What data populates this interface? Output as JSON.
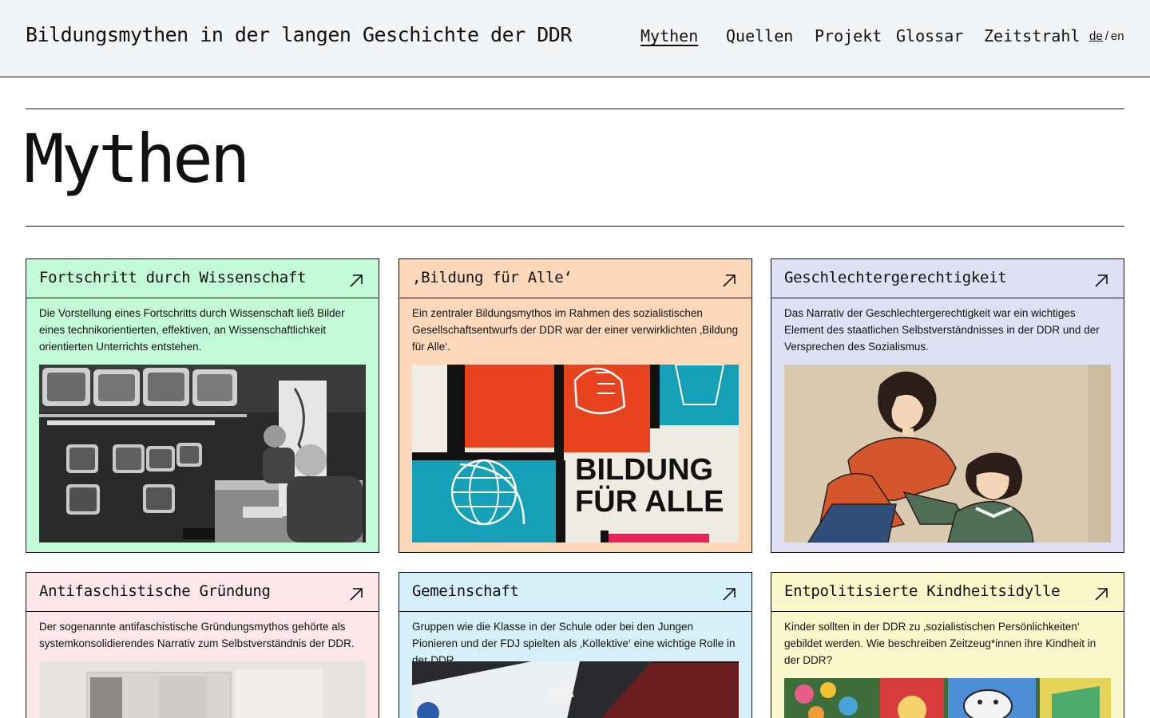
{
  "header": {
    "site_title": "Bildungsmythen in der langen Geschichte der DDR",
    "nav": [
      {
        "label": "Mythen",
        "active": true
      },
      {
        "label": "Quellen",
        "active": false
      },
      {
        "label": "Projekt",
        "active": false
      },
      {
        "label": "Glossar",
        "active": false
      },
      {
        "label": "Zeitstrahl",
        "active": false
      }
    ],
    "lang": {
      "de": "de",
      "sep": "/",
      "en": "en",
      "current": "de"
    }
  },
  "main": {
    "page_title": "Mythen",
    "cards": [
      {
        "title": "Fortschritt durch Wissenschaft",
        "text": "Die Vorstellung eines Fortschritts durch Wissenschaft ließ Bilder eines technikorientierten, effektiven, an Wissenschaftlichkeit orientierten Unterrichts entstehen.",
        "color": "#c3fad8",
        "image": "photo-control-room-monitors"
      },
      {
        "title": "‚Bildung für Alle‘",
        "text": "Ein zentraler Bildungsmythos im Rahmen des sozialistischen Gesellschaftsentwurfs der DDR war der einer verwirklichten ‚Bildung für Alle‘.",
        "color": "#fdd8bb",
        "image": "poster-bildung-fuer-alle",
        "image_text": [
          "BILDUNG",
          "FÜR ALLE"
        ]
      },
      {
        "title": "Geschlechtergerechtigkeit",
        "text": "Das Narrativ der Geschlechtergerechtigkeit war ein wichtiges Element des staatlichen Selbstverständnisses in der DDR und der Versprechen des Sozialismus.",
        "color": "#dfe0f3",
        "image": "illustration-mother-and-child"
      },
      {
        "title": "Antifaschistische Gründung",
        "text": "Der sogenannte antifaschistische Gründungsmythos gehörte als systemkonsolidierendes Narrativ zum Selbstverständnis der DDR.",
        "color": "#fde7ea",
        "image": "photo-historic-building"
      },
      {
        "title": "Gemeinschaft",
        "text": "Gruppen wie die Klasse in der Schule oder bei den Jungen Pionieren und der FDJ spielten als ‚Kollektive‘ eine wichtige Rolle in der DDR...",
        "color": "#d5f0f8",
        "image": "photo-documents-and-books"
      },
      {
        "title": "Entpolitisierte Kindheitsidylle",
        "text": "Kinder sollten in der DDR zu ‚sozialistischen Persönlichkeiten‘ gebildet werden. Wie beschreiben Zeitzeug*innen ihre Kindheit in der DDR?",
        "color": "#fdf8cc",
        "image": "photo-children-books"
      }
    ]
  }
}
